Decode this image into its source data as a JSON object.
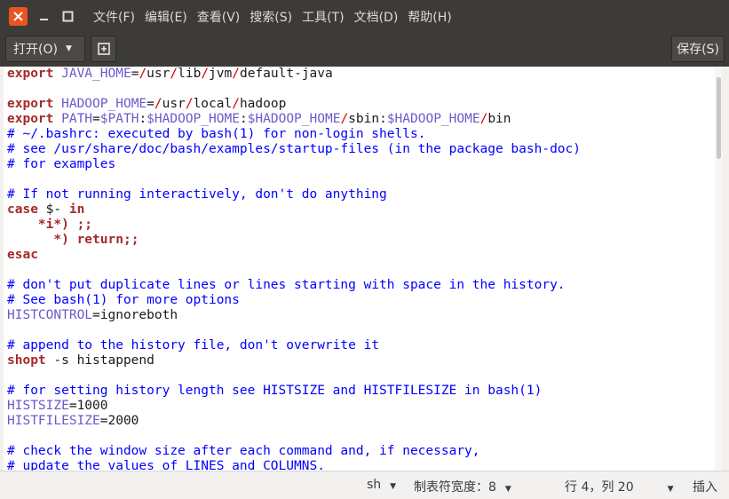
{
  "window": {
    "close_icon": "close-icon",
    "minimize_icon": "minimize-icon",
    "maximize_icon": "maximize-icon"
  },
  "menu": [
    "文件(F)",
    "编辑(E)",
    "查看(V)",
    "搜索(S)",
    "工具(T)",
    "文档(D)",
    "帮助(H)"
  ],
  "toolbar": {
    "open_label": "打开(O)",
    "new_tab_icon": "new-document-icon",
    "save_label": "保存(S)"
  },
  "editor": {
    "lines": [
      [
        [
          "kw",
          "export"
        ],
        [
          "var",
          " JAVA_HOME"
        ],
        [
          "",
          "="
        ],
        [
          "str",
          "/"
        ],
        [
          "",
          "usr"
        ],
        [
          "str",
          "/"
        ],
        [
          "",
          "lib"
        ],
        [
          "str",
          "/"
        ],
        [
          "",
          "jvm"
        ],
        [
          "str",
          "/"
        ],
        [
          "",
          "default-java"
        ]
      ],
      [],
      [
        [
          "kw",
          "export"
        ],
        [
          "var",
          " HADOOP_HOME"
        ],
        [
          "",
          "="
        ],
        [
          "str",
          "/"
        ],
        [
          "",
          "usr"
        ],
        [
          "str",
          "/"
        ],
        [
          "",
          "local"
        ],
        [
          "str",
          "/"
        ],
        [
          "",
          "hadoop"
        ]
      ],
      [
        [
          "kw",
          "export"
        ],
        [
          "var",
          " PATH"
        ],
        [
          "",
          "="
        ],
        [
          "var",
          "$PATH"
        ],
        [
          "",
          ":"
        ],
        [
          "var",
          "$HADOOP_HOME"
        ],
        [
          "",
          ":"
        ],
        [
          "var",
          "$HADOOP_HOME"
        ],
        [
          "str",
          "/"
        ],
        [
          "",
          "sbin:"
        ],
        [
          "var",
          "$HADOOP_HOME"
        ],
        [
          "str",
          "/"
        ],
        [
          "",
          "bin"
        ]
      ],
      [
        [
          "cmt",
          "# ~/.bashrc: executed by bash(1) for non-login shells."
        ]
      ],
      [
        [
          "cmt",
          "# see /usr/share/doc/bash/examples/startup-files (in the package bash-doc)"
        ]
      ],
      [
        [
          "cmt",
          "# for examples"
        ]
      ],
      [],
      [
        [
          "cmt",
          "# If not running interactively, don't do anything"
        ]
      ],
      [
        [
          "kw",
          "case"
        ],
        [
          "",
          " $- "
        ],
        [
          "kw",
          "in"
        ]
      ],
      [
        [
          "",
          "    "
        ],
        [
          "kw",
          "*i*) ;;"
        ]
      ],
      [
        [
          "",
          "      "
        ],
        [
          "kw",
          "*) return;;"
        ]
      ],
      [
        [
          "kw",
          "esac"
        ]
      ],
      [],
      [
        [
          "cmt",
          "# don't put duplicate lines or lines starting with space in the history."
        ]
      ],
      [
        [
          "cmt",
          "# See bash(1) for more options"
        ]
      ],
      [
        [
          "var",
          "HISTCONTROL"
        ],
        [
          "",
          "=ignoreboth"
        ]
      ],
      [],
      [
        [
          "cmt",
          "# append to the history file, don't overwrite it"
        ]
      ],
      [
        [
          "kw",
          "shopt"
        ],
        [
          "",
          " -s histappend"
        ]
      ],
      [],
      [
        [
          "cmt",
          "# for setting history length see HISTSIZE and HISTFILESIZE in bash(1)"
        ]
      ],
      [
        [
          "var",
          "HISTSIZE"
        ],
        [
          "",
          "=1000"
        ]
      ],
      [
        [
          "var",
          "HISTFILESIZE"
        ],
        [
          "",
          "=2000"
        ]
      ],
      [],
      [
        [
          "cmt",
          "# check the window size after each command and, if necessary,"
        ]
      ],
      [
        [
          "cmt",
          "# update the values of LINES and COLUMNS."
        ]
      ]
    ]
  },
  "statusbar": {
    "language": "sh",
    "tab_width": "制表符宽度：8",
    "position": "行 4，列 20",
    "insert_mode": "插入"
  }
}
